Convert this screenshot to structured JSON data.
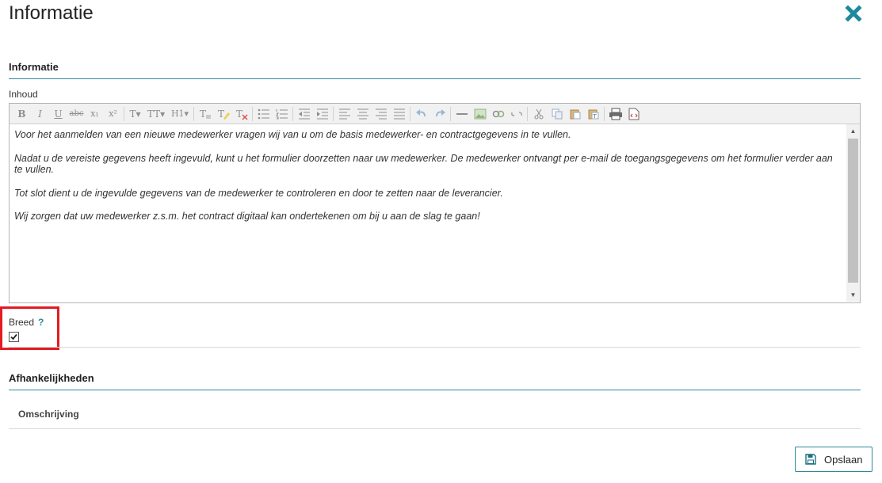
{
  "modal": {
    "title": "Informatie"
  },
  "section_info": {
    "title": "Informatie",
    "content_label": "Inhoud"
  },
  "toolbar": {
    "bold": "B",
    "italic": "I",
    "underline": "U",
    "strike": "abc",
    "subscript": "x₁",
    "superscript": "x²",
    "font_size": "T▾",
    "font_family": "TT▾",
    "heading": "H1▾"
  },
  "editor": {
    "paragraphs": [
      "Voor het aanmelden van een nieuwe medewerker vragen wij van u om de basis medewerker- en contractgegevens in te vullen.",
      "Nadat u de vereiste gegevens heeft ingevuld, kunt u het formulier doorzetten naar uw medewerker. De medewerker ontvangt per e-mail de toegangsgegevens om het formulier verder aan te vullen.",
      "Tot slot dient u de ingevulde gegevens van de medewerker te controleren en door te zetten naar de leverancier.",
      "Wij zorgen dat uw medewerker z.s.m. het contract digitaal kan ondertekenen om bij u aan de slag te gaan!"
    ]
  },
  "breed": {
    "label": "Breed",
    "help": "?",
    "checked": true
  },
  "dependencies": {
    "title": "Afhankelijkheden",
    "column": "Omschrijving"
  },
  "footer": {
    "save_label": "Opslaan"
  },
  "colors": {
    "accent": "#2e8a99",
    "highlight": "#e31b23"
  }
}
